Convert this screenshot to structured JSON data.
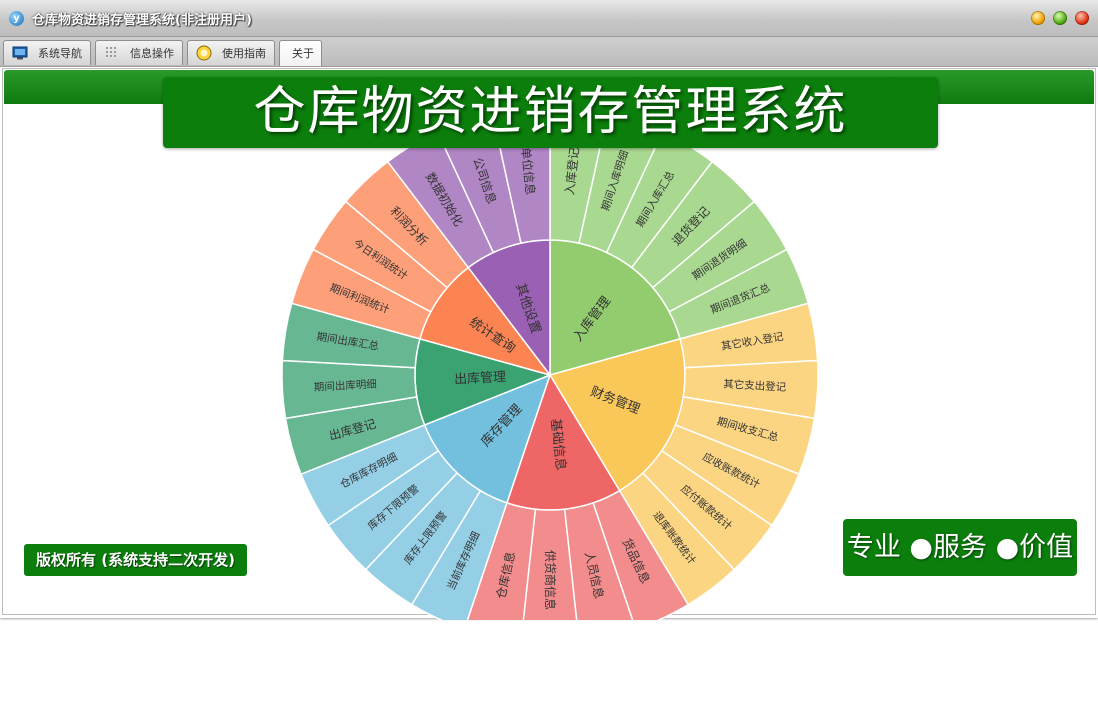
{
  "window": {
    "title": "仓库物资进销存管理系统(非注册用户)",
    "app_icon": "app-logo-icon",
    "buttons": [
      "minimize",
      "maximize",
      "close"
    ]
  },
  "tabs": [
    {
      "label": "系统导航",
      "icon": "monitor-icon",
      "active": false
    },
    {
      "label": "信息操作",
      "icon": "grid-icon",
      "active": false
    },
    {
      "label": "使用指南",
      "icon": "guide-icon",
      "active": false
    },
    {
      "label": "关于",
      "icon": "",
      "active": true
    }
  ],
  "banner": {
    "title": "仓库物资进销存管理系统"
  },
  "footer": {
    "copyright": "版权所有 (系统支持二次开发)",
    "slogan": "专业 ●服务 ●价值"
  },
  "colors": {
    "brand_green": "#0b7e0b",
    "titlebar": "#c7c7c7"
  },
  "sunburst": {
    "categories": [
      {
        "name": "入库管理",
        "color": "#93cc6e",
        "outer_color": "#a9d890",
        "items": [
          "入库登记",
          "期间入库明细",
          "期间入库汇总",
          "退货登记",
          "期间退货明细",
          "期间退货汇总"
        ]
      },
      {
        "name": "财务管理",
        "color": "#fac858",
        "outer_color": "#fcd583",
        "items": [
          "其它收入登记",
          "其它支出登记",
          "期间收支汇总",
          "应收账款统计",
          "应付账款统计",
          "退库账款统计"
        ]
      },
      {
        "name": "基础信息",
        "color": "#ee6666",
        "outer_color": "#f38c8c",
        "items": [
          "货品信息",
          "人员信息",
          "供货商信息",
          "仓库信息"
        ]
      },
      {
        "name": "库存管理",
        "color": "#73c0de",
        "outer_color": "#94cfe6",
        "items": [
          "当前库存明细",
          "库存上限预警",
          "库存下限预警",
          "仓库库存明细"
        ]
      },
      {
        "name": "出库管理",
        "color": "#3ba272",
        "outer_color": "#67b793",
        "items": [
          "出库登记",
          "期间出库明细",
          "期间出库汇总"
        ]
      },
      {
        "name": "统计查询",
        "color": "#fc8452",
        "outer_color": "#fda07a",
        "items": [
          "期间利润统计",
          "今日利润统计",
          "利润分析"
        ]
      },
      {
        "name": "其他设置",
        "color": "#9a60b4",
        "outer_color": "#b086c5",
        "items": [
          "数据初始化",
          "公司信息",
          "单位信息"
        ]
      }
    ]
  }
}
